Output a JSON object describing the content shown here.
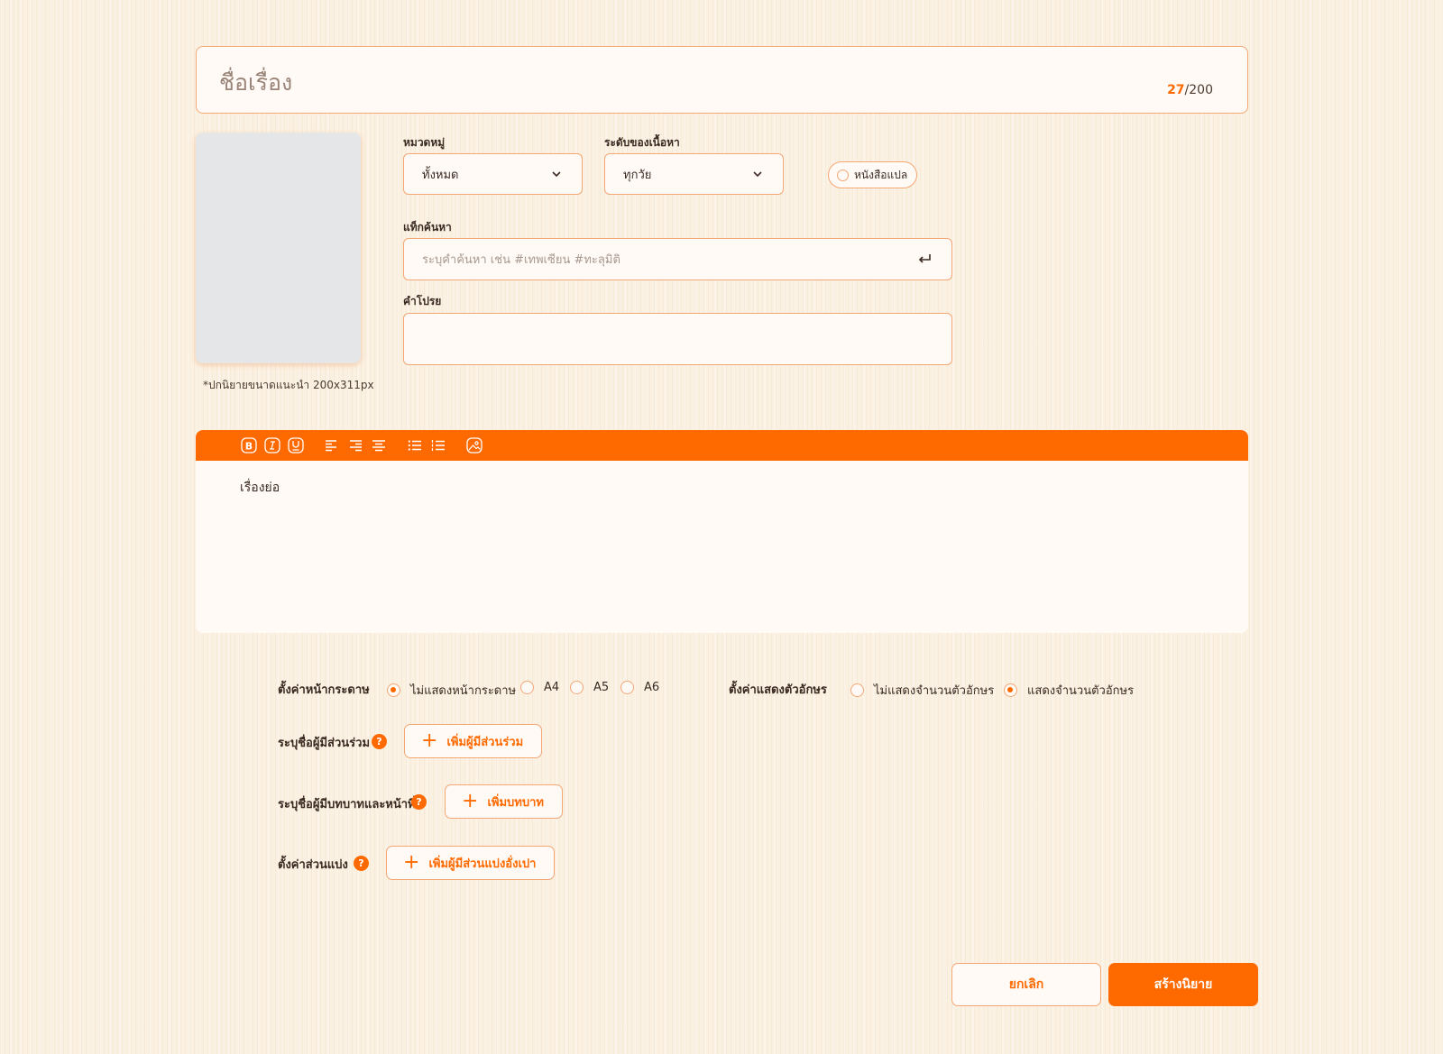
{
  "title": {
    "placeholder": "ชื่อเรื่อง",
    "count_current": "27",
    "count_max": "/200"
  },
  "cover": {
    "hint": "*ปกนิยายขนาดแนะนำ 200x311px"
  },
  "category": {
    "label": "หมวดหมู่",
    "value": "ทั้งหมด"
  },
  "content_level": {
    "label": "ระดับของเนื้อหา",
    "value": "ทุกวัย"
  },
  "translated": {
    "label": "หนังสือแปล"
  },
  "tags": {
    "label": "แท็กค้นหา",
    "placeholder": "ระบุคำค้นหา เช่น #เทพเซียน #ทะลุมิติ"
  },
  "promo": {
    "label": "คำโปรย",
    "value": ""
  },
  "editor": {
    "placeholder": "เรื่องย่อ"
  },
  "page_setting": {
    "label": "ตั้งค่าหน้ากระดาษ",
    "options": [
      "ไม่แสดงหน้ากระดาษ",
      "A4",
      "A5",
      "A6"
    ],
    "selected": "ไม่แสดงหน้ากระดาษ"
  },
  "char_setting": {
    "label": "ตั้งค่าแสดงตัวอักษร",
    "options": [
      "ไม่แสดงจำนวนตัวอักษร",
      "แสดงจำนวนตัวอักษร"
    ],
    "selected": "แสดงจำนวนตัวอักษร"
  },
  "participants": {
    "label": "ระบุชื่อผู้มีส่วนร่วม",
    "button": "เพิ่มผู้มีส่วนร่วม"
  },
  "roles": {
    "label": "ระบุชื่อผู้มีบทบาทและหน้าที่",
    "button": "เพิ่มบทบาท"
  },
  "revenue_share": {
    "label": "ตั้งค่าส่วนแบ่ง",
    "button": "เพิ่มผู้มีส่วนแบ่งอั่งเปา"
  },
  "help_glyph": "?",
  "actions": {
    "cancel": "ยกเลิก",
    "create": "สร้างนิยาย"
  },
  "colors": {
    "accent": "#ff6a00",
    "border": "#f4a673",
    "background": "#fbf1e2"
  },
  "icons": {
    "select": "chevron-down-icon",
    "tag_submit": "enter-icon",
    "toolbar": [
      "bold-icon",
      "italic-icon",
      "underline-icon",
      "align-left-icon",
      "align-right-icon",
      "align-center-icon",
      "bullet-list-icon",
      "numbered-list-icon",
      "image-icon"
    ]
  }
}
